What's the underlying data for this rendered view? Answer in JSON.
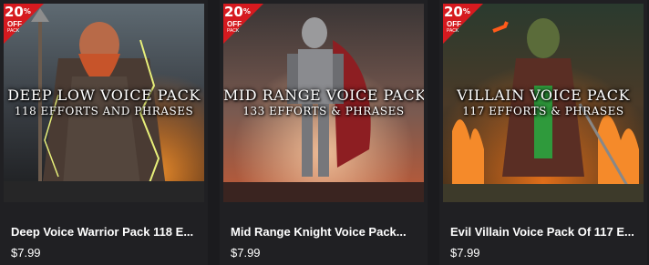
{
  "products": [
    {
      "art_title": "DEEP LOW VOICE PACK",
      "art_subtitle": "118 EFFORTS AND PHRASES",
      "badge_percent": "20",
      "badge_percent_sign": "%",
      "badge_off": "OFF",
      "badge_pack": "PACK",
      "name": "Deep Voice Warrior Pack 118 E...",
      "price": "$7.99"
    },
    {
      "art_title": "MID RANGE VOICE PACK",
      "art_subtitle": "133 EFFORTS & PHRASES",
      "badge_percent": "20",
      "badge_percent_sign": "%",
      "badge_off": "OFF",
      "badge_pack": "PACK",
      "name": "Mid Range Knight Voice Pack...",
      "price": "$7.99"
    },
    {
      "art_title": "VILLAIN VOICE PACK",
      "art_subtitle": "117 EFFORTS & PHRASES",
      "badge_percent": "20",
      "badge_percent_sign": "%",
      "badge_off": "OFF",
      "badge_pack": "PACK",
      "name": "Evil Villain Voice Pack Of 117 E...",
      "price": "$7.99"
    }
  ],
  "colors": {
    "background": "#1b1b1e",
    "card": "#202023",
    "badge_red": "#d61a1f"
  }
}
